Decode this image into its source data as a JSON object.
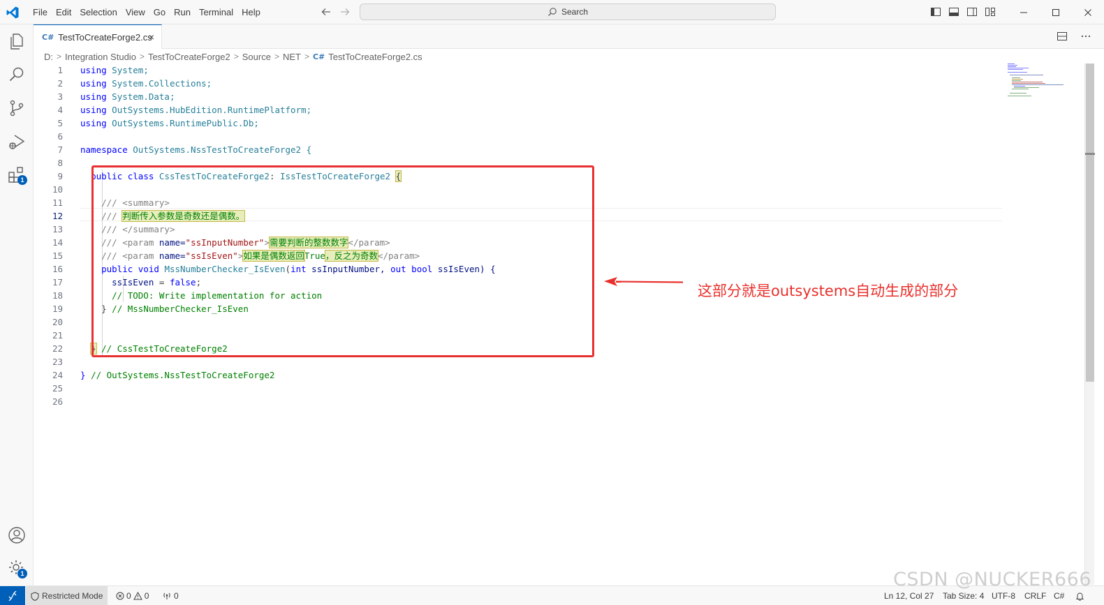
{
  "titlebar": {
    "menu": [
      "File",
      "Edit",
      "Selection",
      "View",
      "Go",
      "Run",
      "Terminal",
      "Help"
    ],
    "search_placeholder": "Search"
  },
  "tab": {
    "icon_glyph": "C#",
    "label": "TestToCreateForge2.cs",
    "close_glyph": "×"
  },
  "breadcrumb": [
    "D:",
    "Integration Studio",
    "TestToCreateForge2",
    "Source",
    "NET",
    "TestToCreateForge2.cs"
  ],
  "editor": {
    "line_numbers": [
      "1",
      "2",
      "3",
      "4",
      "5",
      "6",
      "7",
      "8",
      "9",
      "10",
      "11",
      "12",
      "13",
      "14",
      "15",
      "16",
      "17",
      "18",
      "19",
      "20",
      "21",
      "22",
      "23",
      "24",
      "25",
      "26"
    ],
    "active_line": 12,
    "lines": [
      {
        "kw": "using",
        "rest": "System;"
      },
      {
        "kw": "using",
        "rest": "System.Collections;"
      },
      {
        "kw": "using",
        "rest": "System.Data;"
      },
      {
        "kw": "using",
        "rest": "OutSystems.HubEdition.RuntimePlatform;"
      },
      {
        "kw": "using",
        "rest": "OutSystems.RuntimePublic.Db;"
      },
      {
        "text": ""
      },
      {
        "kw": "namespace",
        "rest": "OutSystems.NssTestToCreateForge2 {"
      },
      {
        "text": ""
      },
      {
        "text": "public class CssTestToCreateForge2: IssTestToCreateForge2 {"
      },
      {
        "text": ""
      },
      {
        "text": "/// <summary>"
      },
      {
        "text": "/// 判断传入参数是奇数还是偶数。"
      },
      {
        "text": "/// </summary>"
      },
      {
        "text": "/// <param name=\"ssInputNumber\">需要判断的整数数字</param>"
      },
      {
        "text": "/// <param name=\"ssIsEven\">如果是偶数返回True，反之为奇数</param>"
      },
      {
        "text": "public void MssNumberChecker_IsEven(int ssInputNumber, out bool ssIsEven) {"
      },
      {
        "text": "ssIsEven = false;"
      },
      {
        "text": "// TODO: Write implementation for action"
      },
      {
        "text": "} // MssNumberChecker_IsEven"
      },
      {
        "text": ""
      },
      {
        "text": ""
      },
      {
        "text": "} // CssTestToCreateForge2"
      },
      {
        "text": ""
      },
      {
        "text": "} // OutSystems.NssTestToCreateForge2"
      },
      {
        "text": ""
      },
      {
        "text": ""
      }
    ],
    "code": {
      "l9_public": "public",
      "l9_class": "class",
      "l9_name": "CssTestToCreateForge2",
      "l9_colon": ":",
      "l9_iface": "IssTestToCreateForge2",
      "l9_brace": "{",
      "doc_prefix": "///",
      "l11_tag": "<summary>",
      "l12_text": "判断传入参数是奇数还是偶数。",
      "l13_tag": "</summary>",
      "param_open": "<param",
      "attr_name": "name=",
      "l14_val": "\"ssInputNumber\"",
      "gt": ">",
      "l14_text": "需要判断的整数数字",
      "param_close": "</param>",
      "l15_val": "\"ssIsEven\"",
      "l15_text1": "如果是偶数返回",
      "l15_true": "True",
      "l15_text2": "，反之为奇数",
      "l16_public": "public",
      "l16_void": "void",
      "l16_name": "MssNumberChecker_IsEven",
      "l16_open": "(",
      "l16_int": "int",
      "l16_p1": "ssInputNumber,",
      "l16_out": "out",
      "l16_bool": "bool",
      "l16_p2": "ssIsEven) {",
      "l17_var": "ssIsEven",
      "l17_eq": " = ",
      "l17_false": "false",
      "l17_semi": ";",
      "l18": "// TODO: Write implementation for action",
      "l19_brace": "}",
      "l19_cm": "// MssNumberChecker_IsEven",
      "l22_brace": "}",
      "l22_cm": "// CssTestToCreateForge2",
      "l24_brace": "}",
      "l24_cm": "// OutSystems.NssTestToCreateForge2"
    }
  },
  "annotation": {
    "text": "这部分就是outsystems自动生成的部分",
    "color": "#e8302c"
  },
  "statusbar": {
    "restricted_mode": "Restricted Mode",
    "errors": "0",
    "warnings": "0",
    "ports": "0",
    "cursor": "Ln 12, Col 27",
    "tab_size": "Tab Size: 4",
    "encoding": "UTF-8",
    "eol": "CRLF",
    "language": "C#"
  },
  "badges": {
    "extensions": "1",
    "settings": "1"
  },
  "watermark": "CSDN @NUCKER666",
  "colors": {
    "accent": "#005fb8",
    "keyword": "#0000ff",
    "type": "#267f99",
    "comment": "#008000"
  }
}
